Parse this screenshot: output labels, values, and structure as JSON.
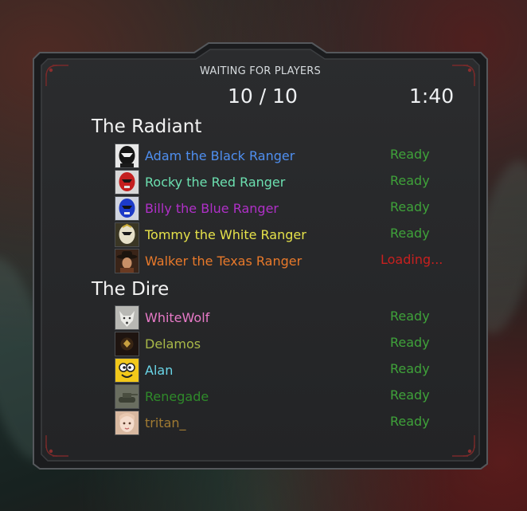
{
  "lobby": {
    "header": "WAITING FOR PLAYERS",
    "count": "10 / 10",
    "timer": "1:40"
  },
  "teams": [
    {
      "name": "The Radiant",
      "players": [
        {
          "name": "Adam the Black Ranger",
          "status": "Ready",
          "color": "#4f8ff0",
          "status_color": "#3fa23a",
          "avatar_icon": "black-ranger-avatar-icon"
        },
        {
          "name": "Rocky the Red Ranger",
          "status": "Ready",
          "color": "#6ce0b0",
          "status_color": "#3fa23a",
          "avatar_icon": "red-ranger-avatar-icon"
        },
        {
          "name": "Billy the Blue Ranger",
          "status": "Ready",
          "color": "#b030c8",
          "status_color": "#3fa23a",
          "avatar_icon": "blue-ranger-avatar-icon"
        },
        {
          "name": "Tommy the White Ranger",
          "status": "Ready",
          "color": "#e6e24a",
          "status_color": "#3fa23a",
          "avatar_icon": "white-ranger-avatar-icon"
        },
        {
          "name": "Walker the Texas Ranger",
          "status": "Loading...",
          "color": "#e8792a",
          "status_color": "#c8201f",
          "avatar_icon": "cowboy-avatar-icon"
        }
      ]
    },
    {
      "name": "The Dire",
      "players": [
        {
          "name": "WhiteWolf",
          "status": "Ready",
          "color": "#e87ac8",
          "status_color": "#3fa23a",
          "avatar_icon": "wolf-avatar-icon"
        },
        {
          "name": "Delamos",
          "status": "Ready",
          "color": "#a8b848",
          "status_color": "#3fa23a",
          "avatar_icon": "dark-avatar-icon"
        },
        {
          "name": "Alan",
          "status": "Ready",
          "color": "#6ad6e8",
          "status_color": "#3fa23a",
          "avatar_icon": "cartoon-avatar-icon"
        },
        {
          "name": "Renegade",
          "status": "Ready",
          "color": "#2f8a2a",
          "status_color": "#3fa23a",
          "avatar_icon": "tank-avatar-icon"
        },
        {
          "name": "tritan_",
          "status": "Ready",
          "color": "#a07a32",
          "status_color": "#3fa23a",
          "avatar_icon": "face-avatar-icon"
        }
      ]
    }
  ]
}
